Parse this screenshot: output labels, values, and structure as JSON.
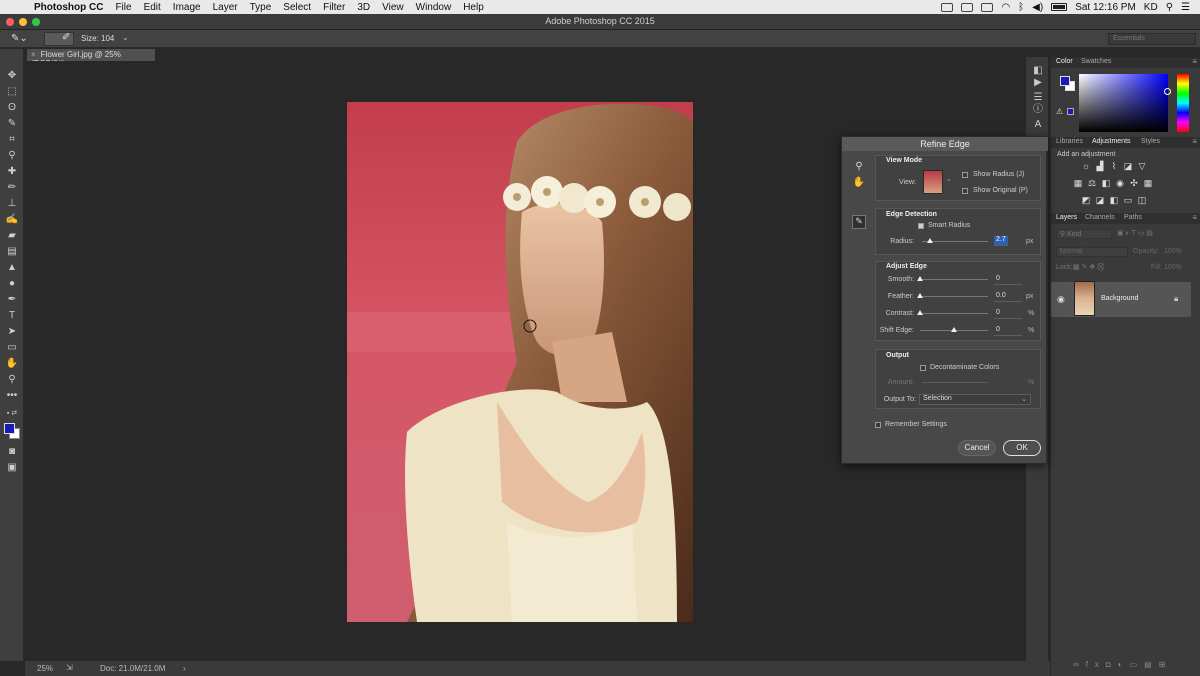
{
  "menubar": {
    "app_name": "Photoshop CC",
    "items": [
      "File",
      "Edit",
      "Image",
      "Layer",
      "Type",
      "Select",
      "Filter",
      "3D",
      "View",
      "Window",
      "Help"
    ],
    "clock": "Sat 12:16 PM",
    "user": "KD"
  },
  "window": {
    "title": "Adobe Photoshop CC 2015"
  },
  "options_bar": {
    "size_label": "Size:",
    "size_value": "104",
    "workspace": "Essentials"
  },
  "document": {
    "tab_title": "Flower Girl.jpg @ 25% (RGB/8#)"
  },
  "status_bar": {
    "zoom": "25%",
    "doc_info": "Doc: 21.0M/21.0M"
  },
  "colors": {
    "foreground": "#1a1ab8",
    "background": "#ffffff",
    "photo_bg": "#c64452",
    "dialog_bg": "#484848",
    "ok_border": "#e0e0e0"
  },
  "panels": {
    "color_tabs": [
      "Color",
      "Swatches"
    ],
    "adj_tabs": [
      "Libraries",
      "Adjustments",
      "Styles"
    ],
    "adj_hint": "Add an adjustment",
    "layers_tabs": [
      "Layers",
      "Channels",
      "Paths"
    ],
    "kind_label": "Kind",
    "blend_mode": "Normal",
    "opacity_label": "Opacity:",
    "opacity_value": "100%",
    "lock_label": "Lock:",
    "fill_label": "Fill:",
    "fill_value": "100%",
    "layer_name": "Background"
  },
  "dialog": {
    "title": "Refine Edge",
    "view_mode": {
      "heading": "View Mode",
      "view_label": "View:",
      "show_radius": "Show Radius (J)",
      "show_original": "Show Original (P)"
    },
    "edge_detection": {
      "heading": "Edge Detection",
      "smart_radius": "Smart Radius",
      "smart_radius_checked": true,
      "radius_label": "Radius:",
      "radius_value": "2.7",
      "radius_unit": "px"
    },
    "adjust_edge": {
      "heading": "Adjust Edge",
      "smooth_label": "Smooth:",
      "smooth_value": "0",
      "feather_label": "Feather:",
      "feather_value": "0.0",
      "feather_unit": "px",
      "contrast_label": "Contrast:",
      "contrast_value": "0",
      "contrast_unit": "%",
      "shift_label": "Shift Edge:",
      "shift_value": "0",
      "shift_unit": "%"
    },
    "output": {
      "heading": "Output",
      "decontaminate": "Decontaminate Colors",
      "amount_label": "Amount:",
      "amount_unit": "%",
      "output_to_label": "Output To:",
      "output_to_value": "Selection"
    },
    "remember": "Remember Settings",
    "cancel": "Cancel",
    "ok": "OK"
  }
}
